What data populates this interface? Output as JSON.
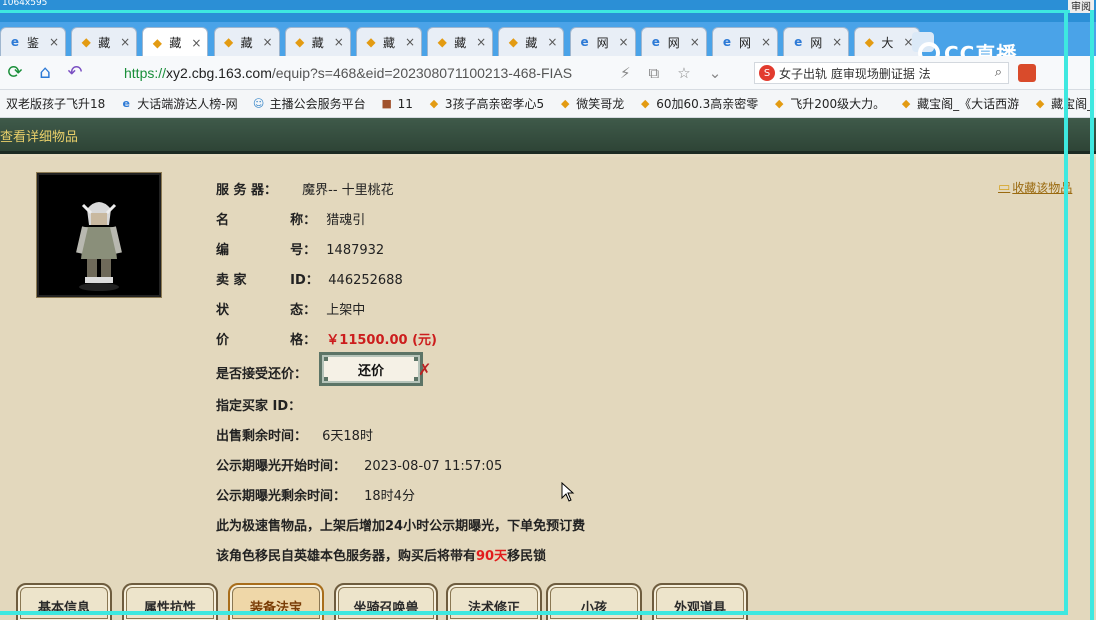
{
  "top": {
    "resolution": "1064x595",
    "right_label": "审阅"
  },
  "tabs": [
    {
      "label": "鉴",
      "icon": "ie-icon"
    },
    {
      "label": "藏",
      "icon": "chick-icon"
    },
    {
      "label": "藏",
      "icon": "chick-icon"
    },
    {
      "label": "藏",
      "icon": "chick-icon"
    },
    {
      "label": "藏",
      "icon": "chick-icon"
    },
    {
      "label": "藏",
      "icon": "chick-icon"
    },
    {
      "label": "藏",
      "icon": "chick-icon"
    },
    {
      "label": "藏",
      "icon": "chick-icon"
    },
    {
      "label": "网",
      "icon": "ie-icon"
    },
    {
      "label": "网",
      "icon": "ie-icon"
    },
    {
      "label": "网",
      "icon": "ie-icon"
    },
    {
      "label": "网",
      "icon": "ie-icon"
    },
    {
      "label": "大",
      "icon": "chick-icon"
    }
  ],
  "logo": {
    "text": "CC直播"
  },
  "address": {
    "scheme": "https://",
    "host": "xy2.cbg.163.com",
    "path": "/equip?s=468&eid=202308071100213-468-FIAS",
    "search_text": "女子出轨 庭审现场删证据 法"
  },
  "bookmarks": [
    {
      "label": "双老版孩子飞升18",
      "icon": "none"
    },
    {
      "label": "大话端游达人榜-网",
      "icon": "ie"
    },
    {
      "label": "主播公会服务平台",
      "icon": "face"
    },
    {
      "label": "11",
      "icon": "game"
    },
    {
      "label": "3孩子高亲密孝心5",
      "icon": "chick"
    },
    {
      "label": "微笑哥龙",
      "icon": "chick"
    },
    {
      "label": "60加60.3高亲密零",
      "icon": "chick"
    },
    {
      "label": "飞升200级大力。",
      "icon": "chick"
    },
    {
      "label": "藏宝阁_《大话西游",
      "icon": "chick"
    },
    {
      "label": "藏宝阁_",
      "icon": "chick"
    }
  ],
  "page": {
    "header": "查看详细物品",
    "favorite": "收藏该物品",
    "fields": {
      "server_label": "服 务 器：",
      "server_value": "魔界-- 十里桃花",
      "name_label_1": "名",
      "name_label_2": "称：",
      "name_value": "猎魂引",
      "id_label_1": "编",
      "id_label_2": "号：",
      "id_value": "1487932",
      "seller_label": "卖 家",
      "seller_label_2": "ID：",
      "seller_value": "446252688",
      "status_label_1": "状",
      "status_label_2": "态：",
      "status_value": "上架中",
      "price_label_1": "价",
      "price_label_2": "格：",
      "price_value": "￥11500.00 (元)",
      "counter_label": "是否接受还价：",
      "counter_button": "还价",
      "buyer_label": "指定买家 ID：",
      "remain_label": "出售剩余时间：",
      "remain_value": "6天18时",
      "public_start_label": "公示期曝光开始时间：",
      "public_start_value": "2023-08-07 11:57:05",
      "public_remain_label": "公示期曝光剩余时间：",
      "public_remain_value": "18时4分",
      "notice_1": "此为极速售物品，上架后增加24小时公示期曝光，下单免预订费",
      "notice_2_a": "该角色移民自英雄本色服务器，购买后将带有",
      "notice_2_b": "90天",
      "notice_2_c": "移民锁"
    },
    "bottom_tabs": [
      "基本信息",
      "属性抗性",
      "装备法宝",
      "坐骑召唤兽",
      "法术修正",
      "小孩",
      "外观道具"
    ],
    "active_tab": "装备法宝"
  }
}
